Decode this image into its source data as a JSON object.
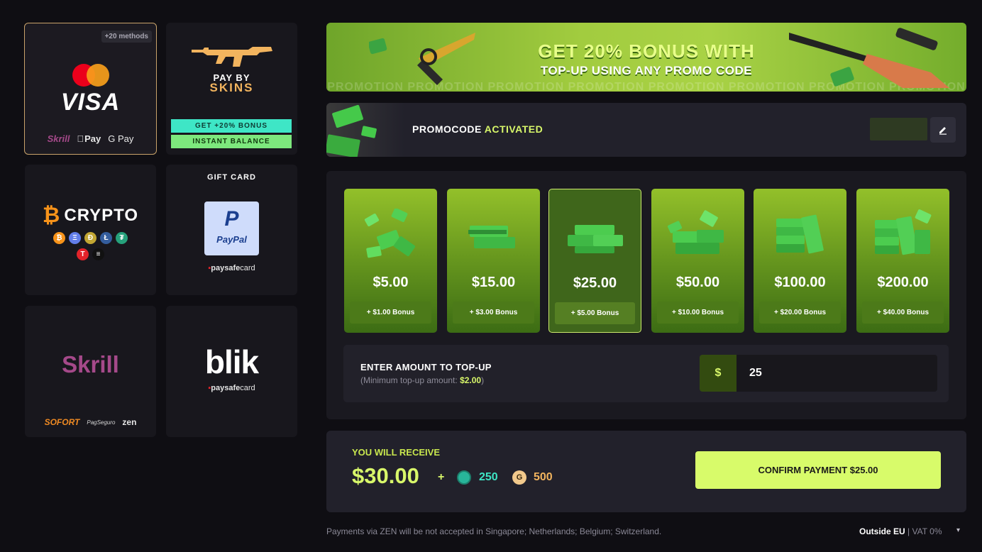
{
  "payment_methods": {
    "cards": {
      "badge": "+20 methods",
      "brand": "VISA",
      "sub_skrill": "Skrill",
      "sub_applepay": "Pay",
      "sub_googlepay": "G Pay"
    },
    "skins": {
      "title_line1": "PAY BY",
      "title_line2": "SKINS",
      "bonus_label": "GET +20% BONUS",
      "instant_label": "INSTANT BALANCE"
    },
    "crypto": {
      "label": "CRYPTO",
      "coins_row1": [
        "₿",
        "Ξ",
        "Ð",
        "Ł",
        "₮"
      ],
      "coins_row2": [
        "T",
        "≡"
      ]
    },
    "gift": {
      "title": "GIFT CARD",
      "paypal_mark": "P",
      "paypal_word": "PayPal",
      "paysafe_prefix": "paysafe",
      "paysafe_suffix": "card"
    },
    "skrill": {
      "label": "Skrill",
      "sofort": "SOFORT",
      "pagseguro": "PagSeguro",
      "zen": "zen"
    },
    "blik": {
      "label": "blik",
      "paysafe_prefix": "paysafe",
      "paysafe_suffix": "card"
    }
  },
  "banner": {
    "line1": "GET 20% BONUS WITH",
    "line2": "TOP-UP USING ANY PROMO CODE",
    "background_text": "PROMOTION PROMOTION PROMOTION PROMOTION PROMOTION PROMOTION PROMOTION PROMOTION"
  },
  "promocode": {
    "label_prefix": "PROMOCODE",
    "label_status": "ACTIVATED",
    "value": ""
  },
  "amounts": [
    {
      "price": "$5.00",
      "bonus": "+ $1.00 Bonus",
      "selected": false
    },
    {
      "price": "$15.00",
      "bonus": "+ $3.00 Bonus",
      "selected": false
    },
    {
      "price": "$25.00",
      "bonus": "+ $5.00 Bonus",
      "selected": true
    },
    {
      "price": "$50.00",
      "bonus": "+ $10.00 Bonus",
      "selected": false
    },
    {
      "price": "$100.00",
      "bonus": "+ $20.00 Bonus",
      "selected": false
    },
    {
      "price": "$200.00",
      "bonus": "+ $40.00 Bonus",
      "selected": false
    }
  ],
  "enter_amount": {
    "title": "ENTER AMOUNT TO TOP-UP",
    "min_prefix": "(Minimum top-up amount: ",
    "min_value": "$2.00",
    "min_suffix": ")",
    "currency_symbol": "$",
    "value": "25"
  },
  "receive": {
    "label": "YOU WILL RECEIVE",
    "amount": "$30.00",
    "plus": "+",
    "token1_value": "250",
    "token2_symbol": "G",
    "token2_value": "500",
    "confirm_label": "CONFIRM PAYMENT $25.00"
  },
  "footer": {
    "note": "Payments via ZEN will be not accepted in Singapore; Netherlands; Belgium; Switzerland.",
    "region": "Outside EU",
    "vat": "| VAT 0%"
  },
  "colors": {
    "accent": "#d8fb6a",
    "background": "#0f0e13",
    "panel": "#22212b",
    "tile_green": "#6a9a1f",
    "token_teal": "#3ee6c6",
    "token_gold": "#f2b45e"
  }
}
